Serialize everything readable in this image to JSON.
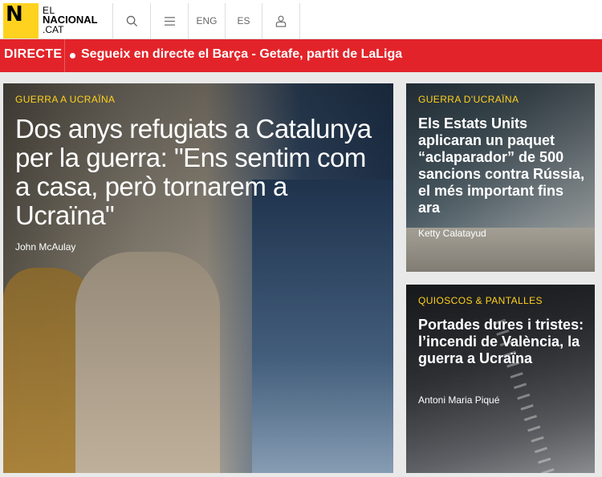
{
  "header": {
    "logo": {
      "letter": "N",
      "line1": "EL",
      "line2": "NACIONAL",
      "line3": ".CAT"
    },
    "search_icon": "search-icon",
    "menu_icon": "menu-icon",
    "lang_eng": "ENG",
    "lang_es": "ES",
    "user_icon": "user-icon",
    "brand_color": "#ffd21f"
  },
  "live": {
    "label": "DIRECTE",
    "text": "Segueix en directe el Barça - Getafe, partit de LaLiga",
    "color": "#e2242a"
  },
  "main_article": {
    "kicker": "GUERRA A UCRAÏNA",
    "title": "Dos anys refugiats a Catalunya per la guerra: \"Ens sentim com a casa, però tornarem a Ucraïna\"",
    "author": "John McAulay"
  },
  "side_articles": [
    {
      "kicker": "GUERRA D'UCRAÏNA",
      "title": "Els Estats Units aplicaran un paquet “aclaparador” de 500 sancions contra Rússia, el més important fins ara",
      "author": "Ketty Calatayud"
    },
    {
      "kicker": "QUIOSCOS & PANTALLES",
      "title": "Portades dures i tristes: l’incendi de València, la guerra a Ucraïna",
      "author": "Antoni Maria Piqué"
    }
  ]
}
